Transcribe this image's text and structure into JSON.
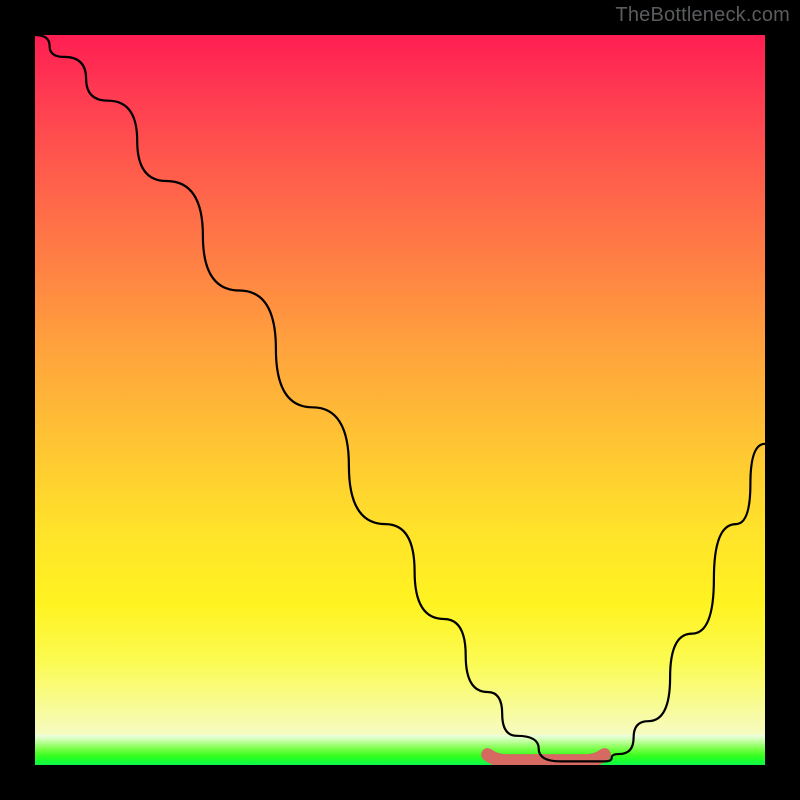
{
  "watermark": "TheBottleneck.com",
  "chart_data": {
    "type": "line",
    "title": "",
    "xlabel": "",
    "ylabel": "",
    "xlim": [
      0,
      100
    ],
    "ylim": [
      0,
      100
    ],
    "grid": false,
    "legend": false,
    "series": [
      {
        "name": "bottleneck-curve",
        "x": [
          0,
          4,
          10,
          18,
          28,
          38,
          48,
          56,
          62,
          66,
          72,
          78,
          80,
          84,
          90,
          96,
          100
        ],
        "y": [
          100,
          97,
          91,
          80,
          65,
          49,
          33,
          20,
          10,
          4,
          0.5,
          0.5,
          1.5,
          6,
          18,
          33,
          44
        ]
      }
    ],
    "valley_highlight": {
      "x": [
        62,
        78
      ],
      "y": 0.6,
      "color": "#d66a63"
    },
    "background_gradient": {
      "stops": [
        {
          "pos": 0.0,
          "color": "#ff1e52"
        },
        {
          "pos": 0.3,
          "color": "#ff7d45"
        },
        {
          "pos": 0.6,
          "color": "#ffd62e"
        },
        {
          "pos": 0.9,
          "color": "#f8fb96"
        },
        {
          "pos": 0.96,
          "color": "#b9ff95"
        },
        {
          "pos": 1.0,
          "color": "#0ff64c"
        }
      ]
    }
  }
}
